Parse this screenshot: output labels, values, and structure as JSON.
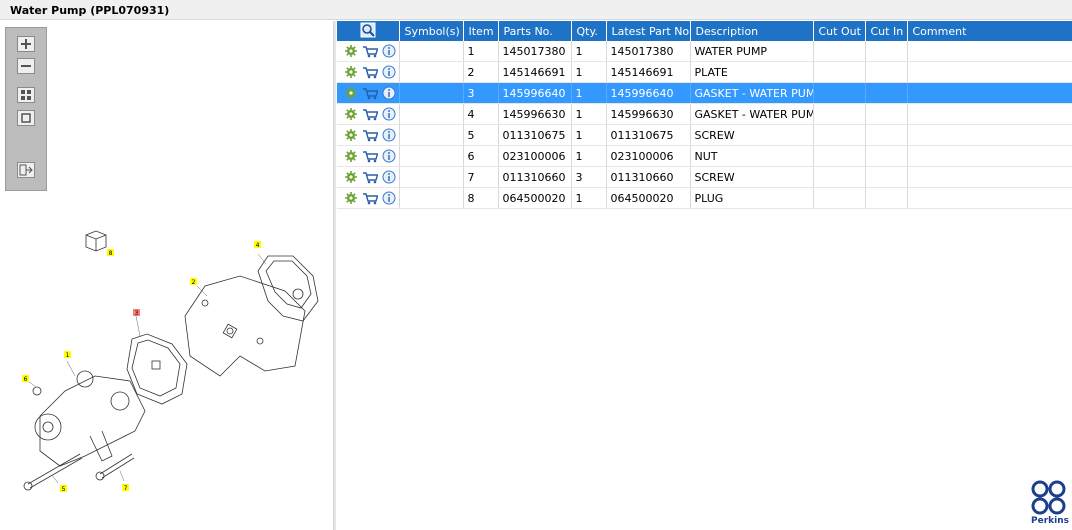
{
  "window": {
    "title": "Water Pump (PPL070931)"
  },
  "toolbar": {
    "buttons": [
      {
        "name": "zoom-in",
        "icon": "plus-icon"
      },
      {
        "name": "zoom-out",
        "icon": "minus-icon"
      },
      {
        "name": "fit-all",
        "icon": "grid-icon"
      },
      {
        "name": "fit-window",
        "icon": "square-icon"
      },
      {
        "name": "export",
        "icon": "export-icon"
      }
    ]
  },
  "drawing": {
    "callouts": [
      "1",
      "2",
      "3",
      "4",
      "5",
      "6",
      "7",
      "8"
    ]
  },
  "table": {
    "columns": [
      "",
      "Symbol(s)",
      "Item",
      "Parts No.",
      "Qty.",
      "Latest Part No.",
      "Description",
      "Cut Out",
      "Cut In",
      "Comment"
    ],
    "rows": [
      {
        "item": "1",
        "parts_no": "145017380",
        "qty": "1",
        "latest": "145017380",
        "desc": "WATER PUMP"
      },
      {
        "item": "2",
        "parts_no": "145146691",
        "qty": "1",
        "latest": "145146691",
        "desc": "PLATE"
      },
      {
        "item": "3",
        "parts_no": "145996640",
        "qty": "1",
        "latest": "145996640",
        "desc": "GASKET - WATER PUMP"
      },
      {
        "item": "4",
        "parts_no": "145996630",
        "qty": "1",
        "latest": "145996630",
        "desc": "GASKET - WATER PUMP"
      },
      {
        "item": "5",
        "parts_no": "011310675",
        "qty": "1",
        "latest": "011310675",
        "desc": "SCREW"
      },
      {
        "item": "6",
        "parts_no": "023100006",
        "qty": "1",
        "latest": "023100006",
        "desc": "NUT"
      },
      {
        "item": "7",
        "parts_no": "011310660",
        "qty": "3",
        "latest": "011310660",
        "desc": "SCREW"
      },
      {
        "item": "8",
        "parts_no": "064500020",
        "qty": "1",
        "latest": "064500020",
        "desc": "PLUG"
      }
    ],
    "selected_row": 3
  },
  "logo": {
    "text": "Perkins"
  },
  "colors": {
    "header": "#1e73c7",
    "selection": "#3399ff",
    "gear": "#6aa331",
    "cart": "#2a5ea8",
    "info": "#3a78c9"
  }
}
